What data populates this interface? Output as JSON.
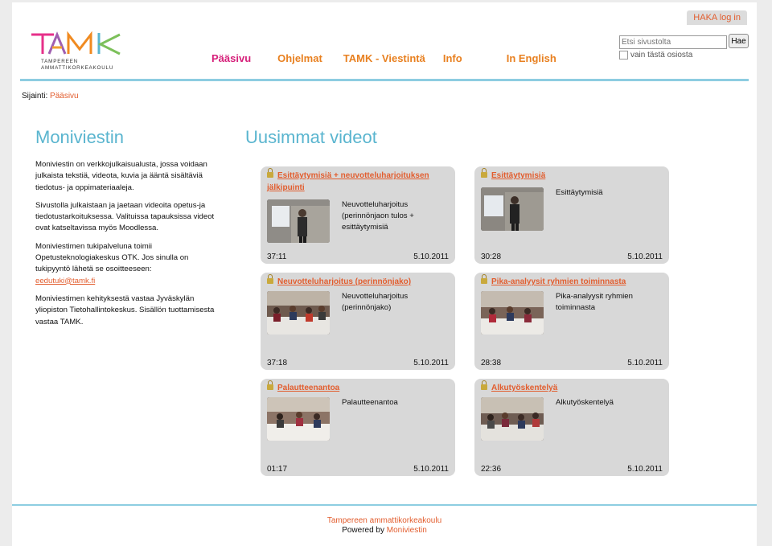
{
  "header": {
    "haka_login": "HAKA log in",
    "logo_text": "TAMK",
    "logo_sub_line1": "TAMPEREEN",
    "logo_sub_line2": "AMMATTIKORKEAKOULU",
    "nav": [
      {
        "label": "Pääsivu",
        "color": "#d6207a"
      },
      {
        "label": "Ohjelmat",
        "color": "#e88020"
      },
      {
        "label": "TAMK - Viestintä",
        "color": "#e88020"
      },
      {
        "label": "Info",
        "color": "#e88020"
      },
      {
        "label": "In English",
        "color": "#e88020"
      }
    ],
    "search_placeholder": "Etsi sivustolta",
    "search_button": "Hae",
    "search_scope_label": "vain tästä osiosta"
  },
  "breadcrumb": {
    "prefix": "Sijainti:",
    "current": "Pääsivu"
  },
  "left": {
    "title": "Moniviestin",
    "p1": "Moniviestin on verkkojulkaisualusta, jossa voidaan julkaista tekstiä, videota, kuvia ja ääntä sisältäviä tiedotus- ja oppimateriaaleja.",
    "p2": "Sivustolla julkaistaan ja jaetaan videoita opetus-ja tiedotustarkoituksessa. Valituissa tapauksissa videot ovat katseltavissa myös Moodlessa.",
    "p3": "Moniviestimen tukipalveluna toimii Opetusteknologiakeskus OTK. Jos sinulla on tukipyyntö lähetä se osoitteeseen:",
    "email": "eedutuki@tamk.fi",
    "p4": "Moniviestimen kehityksestä vastaa Jyväskylän yliopiston Tietohallintokeskus. Sisällön tuottamisesta vastaa TAMK."
  },
  "videos": {
    "title": "Uusimmat videot",
    "items": [
      {
        "title": "Esittäytymisiä + neuvotteluharjoituksen jälkipuinti",
        "desc": "Neuvotteluharjoitus (perinnönjaon tulos + esittäytymisiä",
        "duration": "37:11",
        "date": "5.10.2011",
        "scene": "presenter"
      },
      {
        "title": "Esittäytymisiä",
        "desc": "Esittäytymisiä",
        "duration": "30:28",
        "date": "5.10.2011",
        "scene": "presenter"
      },
      {
        "title": "Neuvotteluharjoitus (perinnönjako)",
        "desc": "Neuvotteluharjoitus (perinnönjako)",
        "duration": "37:18",
        "date": "5.10.2011",
        "scene": "group"
      },
      {
        "title": "Pika-analyysit ryhmien toiminnasta",
        "desc": "Pika-analyysit ryhmien toiminnasta",
        "duration": "28:38",
        "date": "5.10.2011",
        "scene": "group"
      },
      {
        "title": "Palautteenantoa",
        "desc": "Palautteenantoa",
        "duration": "01:17",
        "date": "5.10.2011",
        "scene": "group"
      },
      {
        "title": "Alkutyöskentelyä",
        "desc": "Alkutyöskentelyä",
        "duration": "22:36",
        "date": "5.10.2011",
        "scene": "group"
      }
    ]
  },
  "footer": {
    "org": "Tampereen ammattikorkeakoulu",
    "powered_prefix": "Powered by",
    "powered_link": "Moniviestin"
  }
}
